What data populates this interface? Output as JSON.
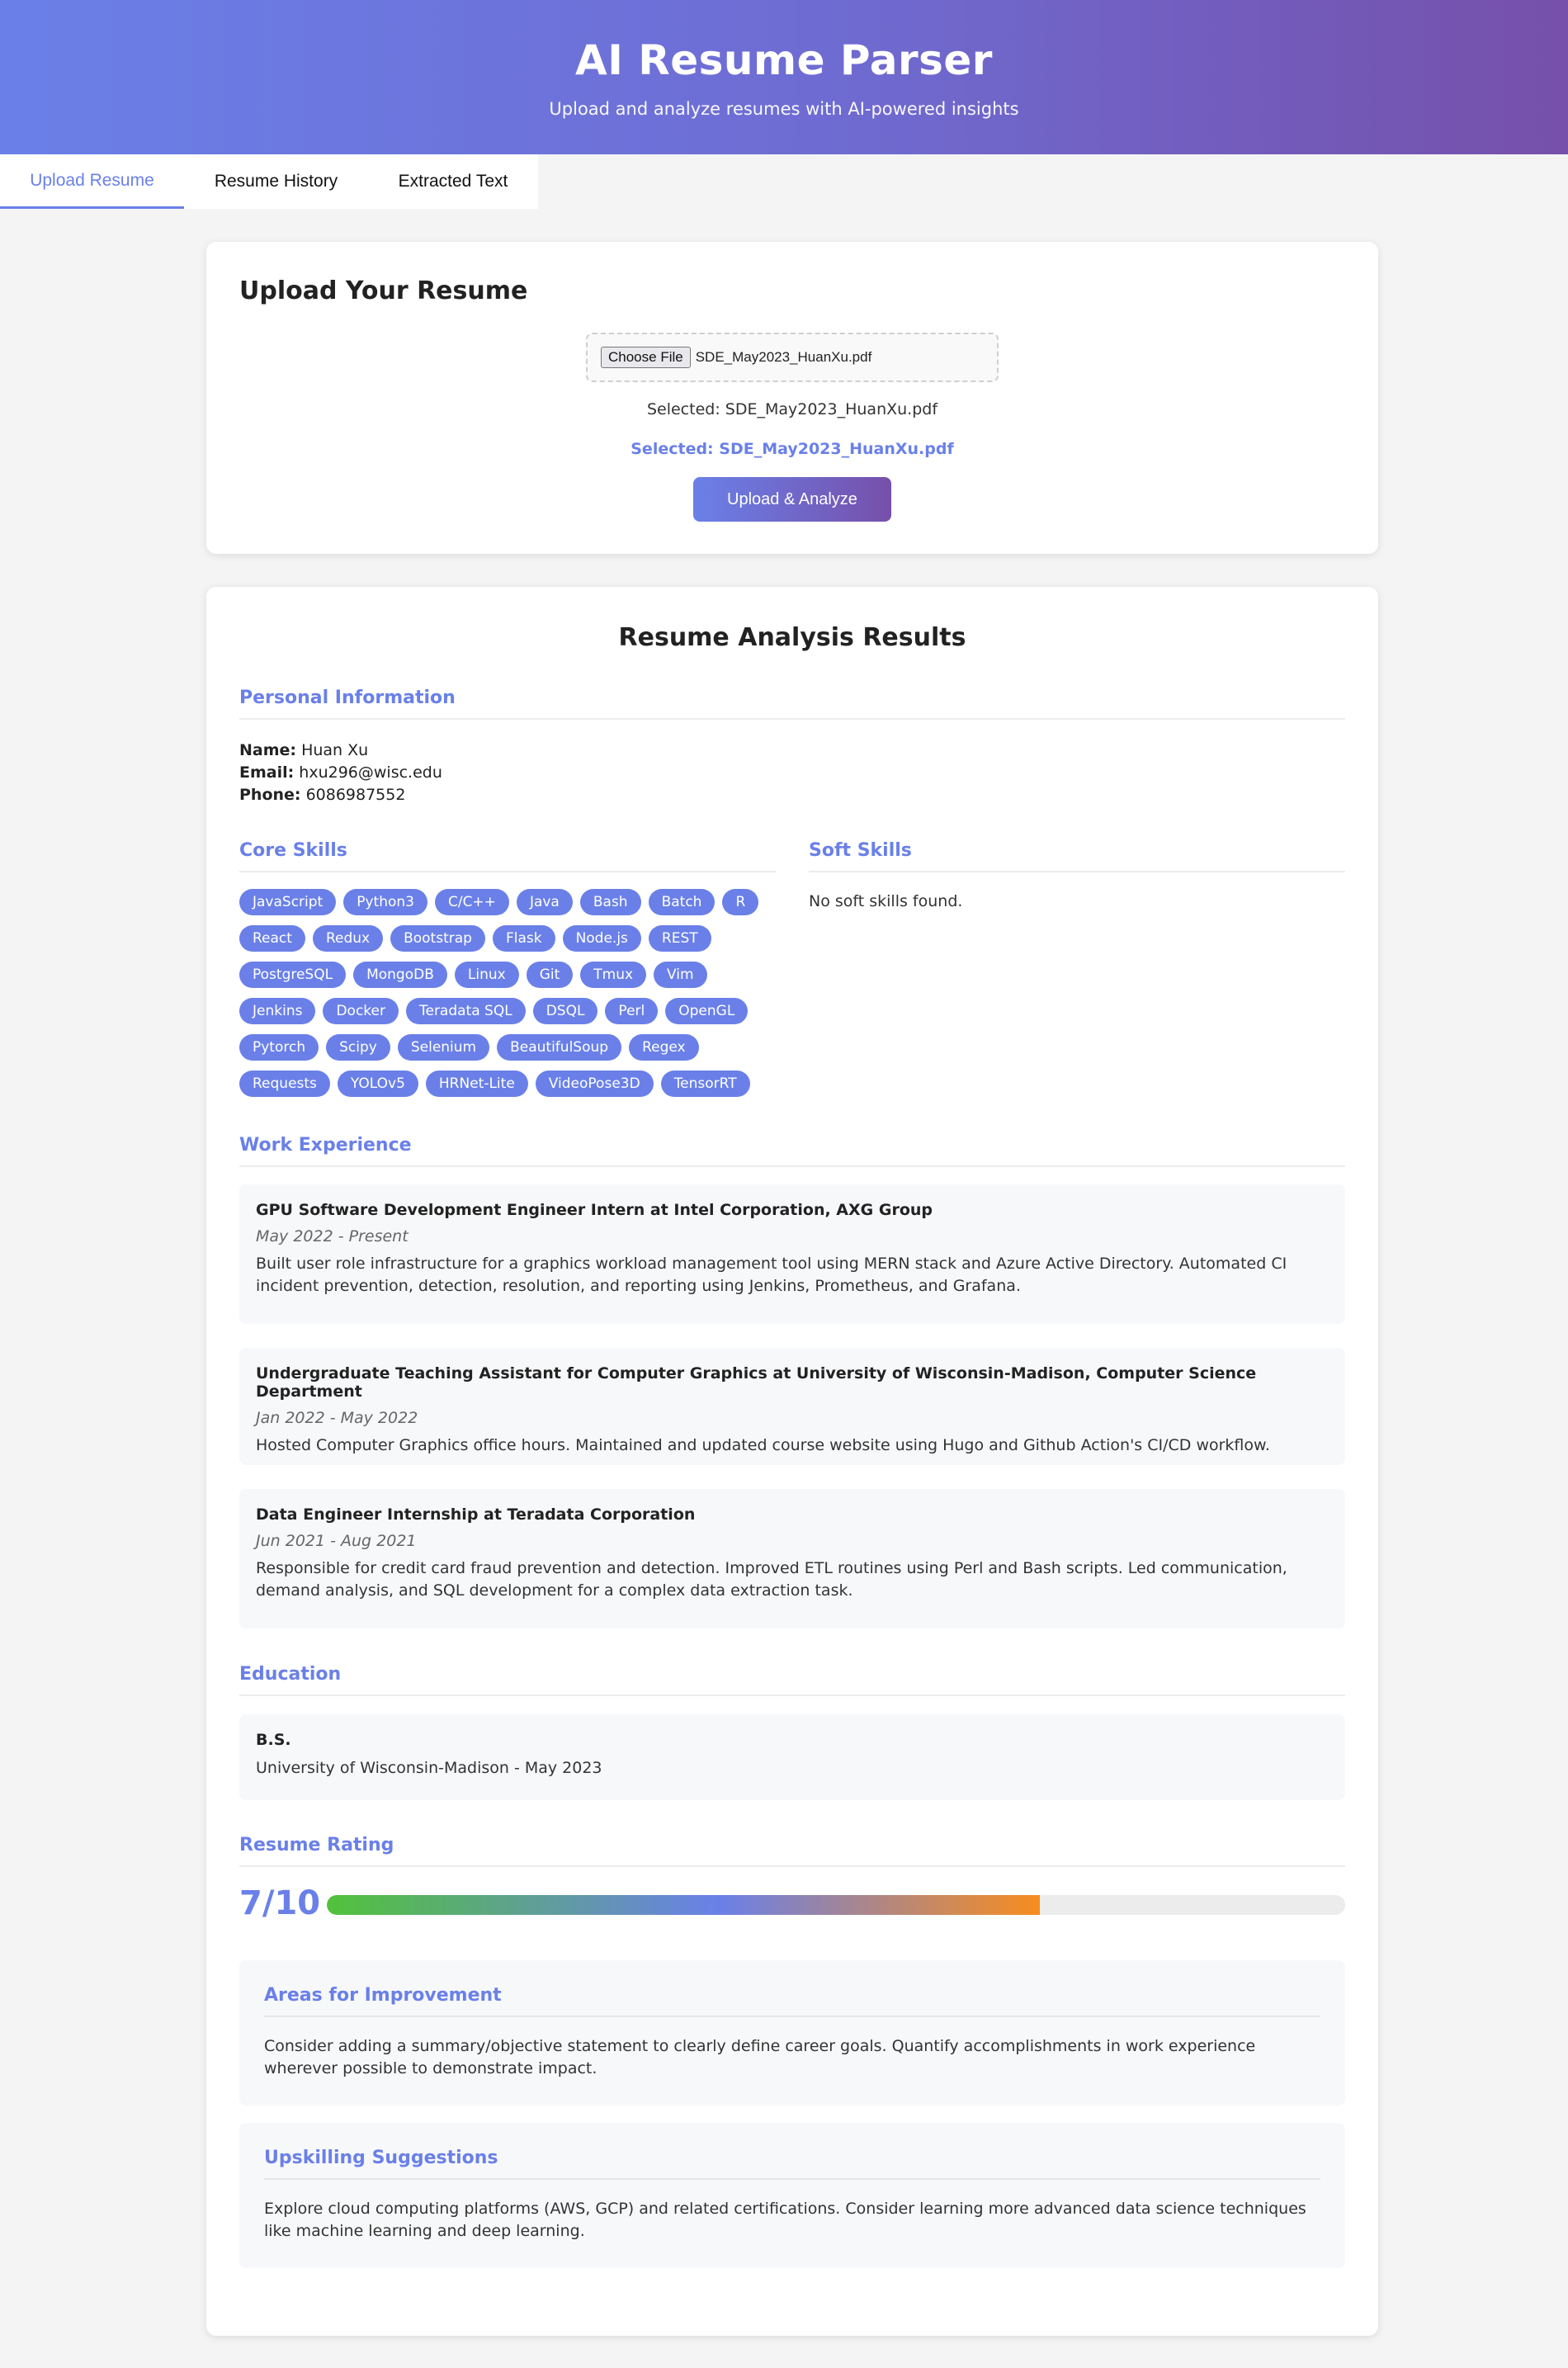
{
  "header": {
    "title": "AI Resume Parser",
    "subtitle": "Upload and analyze resumes with AI-powered insights"
  },
  "tabs": [
    {
      "label": "Upload Resume",
      "active": true
    },
    {
      "label": "Resume History",
      "active": false
    },
    {
      "label": "Extracted Text",
      "active": false
    }
  ],
  "upload": {
    "title": "Upload Your Resume",
    "choose_file_label": "Choose File",
    "file_name": "SDE_May2023_HuanXu.pdf",
    "selected_text": "Selected: SDE_May2023_HuanXu.pdf",
    "selected_highlight": "Selected: SDE_May2023_HuanXu.pdf",
    "button_label": "Upload & Analyze"
  },
  "results": {
    "title": "Resume Analysis Results",
    "personal": {
      "heading": "Personal Information",
      "name_label": "Name:",
      "name": "Huan Xu",
      "email_label": "Email:",
      "email": "hxu296@wisc.edu",
      "phone_label": "Phone:",
      "phone": "6086987552"
    },
    "core_skills_heading": "Core Skills",
    "core_skills": [
      "JavaScript",
      "Python3",
      "C/C++",
      "Java",
      "Bash",
      "Batch",
      "R",
      "React",
      "Redux",
      "Bootstrap",
      "Flask",
      "Node.js",
      "REST",
      "PostgreSQL",
      "MongoDB",
      "Linux",
      "Git",
      "Tmux",
      "Vim",
      "Jenkins",
      "Docker",
      "Teradata SQL",
      "DSQL",
      "Perl",
      "OpenGL",
      "Pytorch",
      "Scipy",
      "Selenium",
      "BeautifulSoup",
      "Regex",
      "Requests",
      "YOLOv5",
      "HRNet-Lite",
      "VideoPose3D",
      "TensorRT"
    ],
    "soft_skills_heading": "Soft Skills",
    "soft_skills_empty": "No soft skills found.",
    "work_heading": "Work Experience",
    "work": [
      {
        "title": "GPU Software Development Engineer Intern at Intel Corporation, AXG Group",
        "date": "May 2022 - Present",
        "desc": "Built user role infrastructure for a graphics workload management tool using MERN stack and Azure Active Directory. Automated CI incident prevention, detection, resolution, and reporting using Jenkins, Prometheus, and Grafana."
      },
      {
        "title": "Undergraduate Teaching Assistant for Computer Graphics at University of Wisconsin-Madison, Computer Science Department",
        "date": "Jan 2022 - May 2022",
        "desc": "Hosted Computer Graphics office hours. Maintained and updated course website using Hugo and Github Action's CI/CD workflow."
      },
      {
        "title": "Data Engineer Internship at Teradata Corporation",
        "date": "Jun 2021 - Aug 2021",
        "desc": "Responsible for credit card fraud prevention and detection. Improved ETL routines using Perl and Bash scripts. Led communication, demand analysis, and SQL development for a complex data extraction task."
      }
    ],
    "education_heading": "Education",
    "education": {
      "degree": "B.S.",
      "school": "University of Wisconsin-Madison - May 2023"
    },
    "rating_heading": "Resume Rating",
    "rating_text": "7/10",
    "rating_value": 0.7,
    "improvement": {
      "heading": "Areas for Improvement",
      "text": "Consider adding a summary/objective statement to clearly define career goals. Quantify accomplishments in work experience wherever possible to demonstrate impact."
    },
    "upskilling": {
      "heading": "Upskilling Suggestions",
      "text": "Explore cloud computing platforms (AWS, GCP) and related certifications. Consider learning more advanced data science techniques like machine learning and deep learning."
    }
  }
}
